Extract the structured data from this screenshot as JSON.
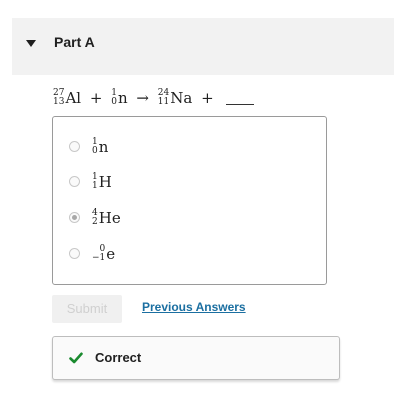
{
  "part": {
    "title": "Part A",
    "expanded_icon": "caret-down-icon"
  },
  "equation": {
    "reactant1": {
      "mass": "27",
      "atomic": "13",
      "symbol": "Al"
    },
    "plus1": "+",
    "reactant2": {
      "mass": "1",
      "atomic": "0",
      "symbol": "n"
    },
    "arrow": "→",
    "product1": {
      "mass": "24",
      "atomic": "11",
      "symbol": "Na"
    },
    "plus2": "+"
  },
  "choices": [
    {
      "mass": "1",
      "atomic": "0",
      "symbol": "n",
      "selected": false
    },
    {
      "mass": "1",
      "atomic": "1",
      "symbol": "H",
      "selected": false
    },
    {
      "mass": "4",
      "atomic": "2",
      "symbol": "He",
      "selected": true
    },
    {
      "mass": "0",
      "atomic": "−1",
      "symbol": "e",
      "selected": false
    }
  ],
  "actions": {
    "submit_label": "Submit",
    "previous_answers_label": "Previous Answers"
  },
  "feedback": {
    "status": "Correct",
    "icon": "checkmark-icon",
    "color": "#1a8a2f"
  }
}
